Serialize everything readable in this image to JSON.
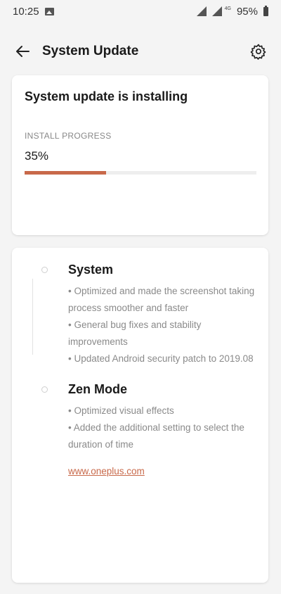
{
  "status_bar": {
    "time": "10:25",
    "network": "4G",
    "battery": "95%"
  },
  "header": {
    "title": "System Update",
    "back_icon": "arrow-left-icon",
    "settings_icon": "gear-icon"
  },
  "install": {
    "title": "System update is installing",
    "progress_label": "INSTALL PROGRESS",
    "progress_text": "35%",
    "progress_value": 0.35,
    "accent_color": "#c8694a"
  },
  "notes": {
    "sections": [
      {
        "title": "System",
        "items": [
          "• Optimized and made the screenshot taking process smoother and faster",
          "• General bug fixes and stability improvements",
          "• Updated Android security patch to 2019.08"
        ]
      },
      {
        "title": "Zen Mode",
        "items": [
          "• Optimized visual effects",
          "• Added the additional setting to select the duration of time"
        ]
      }
    ],
    "link": "www.oneplus.com"
  }
}
